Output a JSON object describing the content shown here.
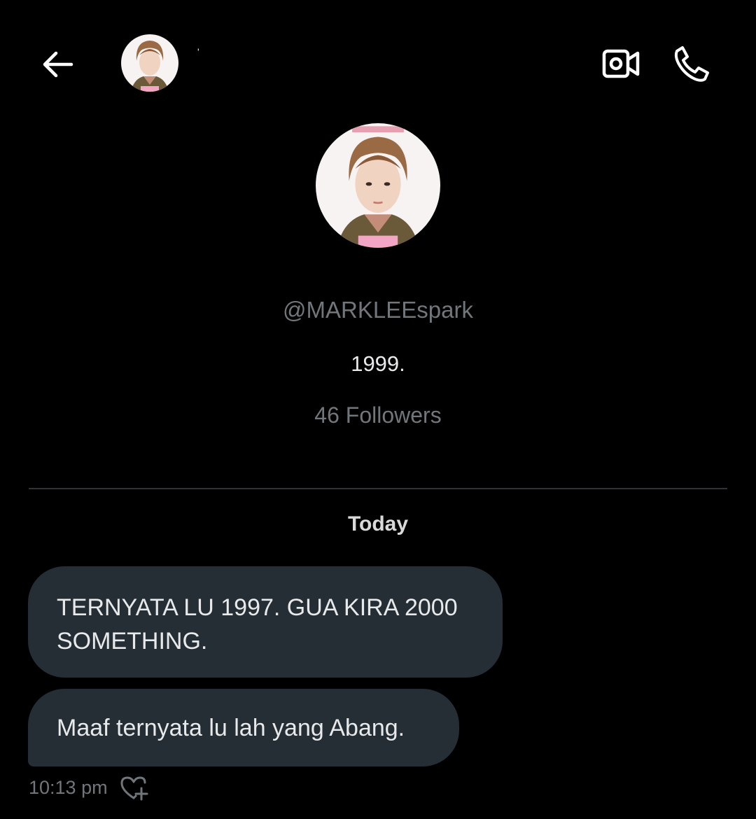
{
  "header": {
    "back_icon": "arrow-left-icon",
    "name": "'",
    "avatar_icon": "user-avatar",
    "video_icon": "video-call-icon",
    "call_icon": "phone-icon"
  },
  "profile": {
    "handle": "@MARKLEEspark",
    "bio": "1999.",
    "followers": "46 Followers"
  },
  "conversation": {
    "date_separator": "Today",
    "messages": [
      {
        "text": "TERNYATA LU 1997. GUA KIRA 2000 SOMETHING."
      },
      {
        "text": "Maaf ternyata lu lah yang Abang."
      }
    ],
    "last_timestamp": "10:13 pm",
    "react_icon": "heart-plus-icon"
  },
  "colors": {
    "background": "#000000",
    "bubble": "#252d35",
    "text_primary": "#e7e9ea",
    "text_secondary": "#71767b",
    "divider": "#2f3336"
  }
}
